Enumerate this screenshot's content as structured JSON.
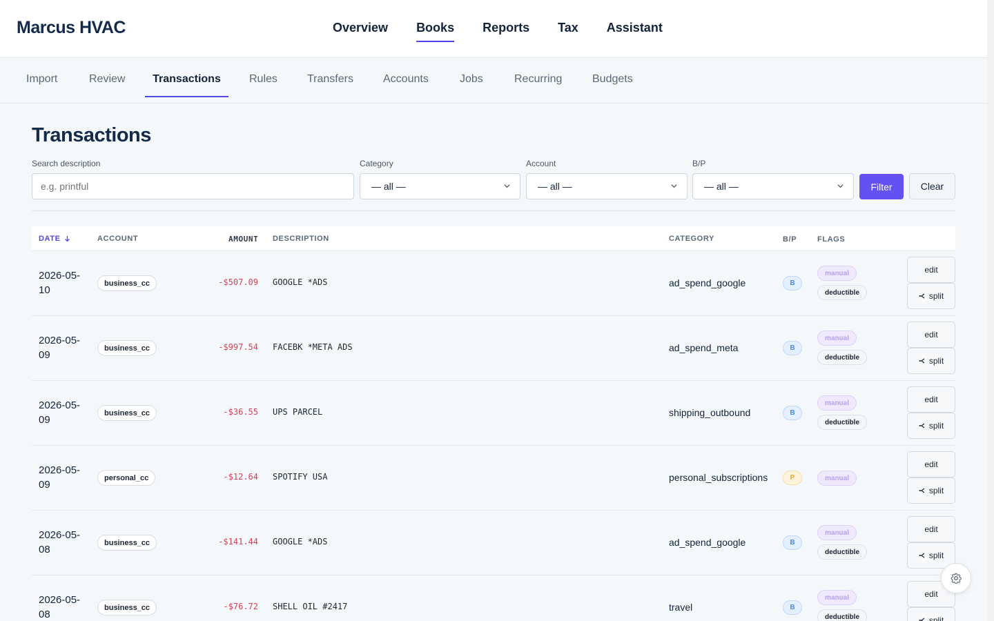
{
  "app": {
    "brand": "Marcus HVAC"
  },
  "main_nav": [
    {
      "label": "Overview",
      "active": false
    },
    {
      "label": "Books",
      "active": true
    },
    {
      "label": "Reports",
      "active": false
    },
    {
      "label": "Tax",
      "active": false
    },
    {
      "label": "Assistant",
      "active": false
    }
  ],
  "sub_nav": [
    {
      "label": "Import",
      "active": false
    },
    {
      "label": "Review",
      "active": false
    },
    {
      "label": "Transactions",
      "active": true
    },
    {
      "label": "Rules",
      "active": false
    },
    {
      "label": "Transfers",
      "active": false
    },
    {
      "label": "Accounts",
      "active": false
    },
    {
      "label": "Jobs",
      "active": false
    },
    {
      "label": "Recurring",
      "active": false
    },
    {
      "label": "Budgets",
      "active": false
    }
  ],
  "page": {
    "title": "Transactions"
  },
  "filters": {
    "search_label": "Search description",
    "search_placeholder": "e.g. printful",
    "search_value": "",
    "category_label": "Category",
    "category_value": "— all —",
    "account_label": "Account",
    "account_value": "— all —",
    "bp_label": "B/P",
    "bp_value": "— all —",
    "filter_button": "Filter",
    "clear_button": "Clear"
  },
  "table": {
    "headers": {
      "date": "DATE",
      "account": "ACCOUNT",
      "amount": "AMOUNT",
      "description": "DESCRIPTION",
      "category": "CATEGORY",
      "bp": "B/P",
      "flags": "FLAGS"
    },
    "sort": {
      "column": "date",
      "direction": "desc"
    },
    "edit_label": "edit",
    "split_label": "split",
    "rows": [
      {
        "date": "2026-05-10",
        "account": "business_cc",
        "amount": "-$507.09",
        "description": "GOOGLE *ADS",
        "category": "ad_spend_google",
        "bp": "B",
        "flags": [
          "manual",
          "deductible"
        ]
      },
      {
        "date": "2026-05-09",
        "account": "business_cc",
        "amount": "-$997.54",
        "description": "FACEBK *META ADS",
        "category": "ad_spend_meta",
        "bp": "B",
        "flags": [
          "manual",
          "deductible"
        ]
      },
      {
        "date": "2026-05-09",
        "account": "business_cc",
        "amount": "-$36.55",
        "description": "UPS PARCEL",
        "category": "shipping_outbound",
        "bp": "B",
        "flags": [
          "manual",
          "deductible"
        ]
      },
      {
        "date": "2026-05-09",
        "account": "personal_cc",
        "amount": "-$12.64",
        "description": "SPOTIFY USA",
        "category": "personal_subscriptions",
        "bp": "P",
        "flags": [
          "manual"
        ]
      },
      {
        "date": "2026-05-08",
        "account": "business_cc",
        "amount": "-$141.44",
        "description": "GOOGLE *ADS",
        "category": "ad_spend_google",
        "bp": "B",
        "flags": [
          "manual",
          "deductible"
        ]
      },
      {
        "date": "2026-05-08",
        "account": "business_cc",
        "amount": "-$76.72",
        "description": "SHELL OIL #2417",
        "category": "travel",
        "bp": "B",
        "flags": [
          "manual",
          "deductible"
        ]
      }
    ]
  },
  "colors": {
    "accent": "#4f46e5",
    "filter_button": "#6352f1",
    "negative_amount": "#d8415a",
    "manual_flag": "#b6a2ef",
    "business_badge": "#4a8ee0",
    "personal_badge": "#dea43a"
  },
  "icons": {
    "sort": "arrow-down-icon",
    "dropdown": "chevron-down-icon",
    "split": "split-icon",
    "settings": "gear-icon"
  }
}
